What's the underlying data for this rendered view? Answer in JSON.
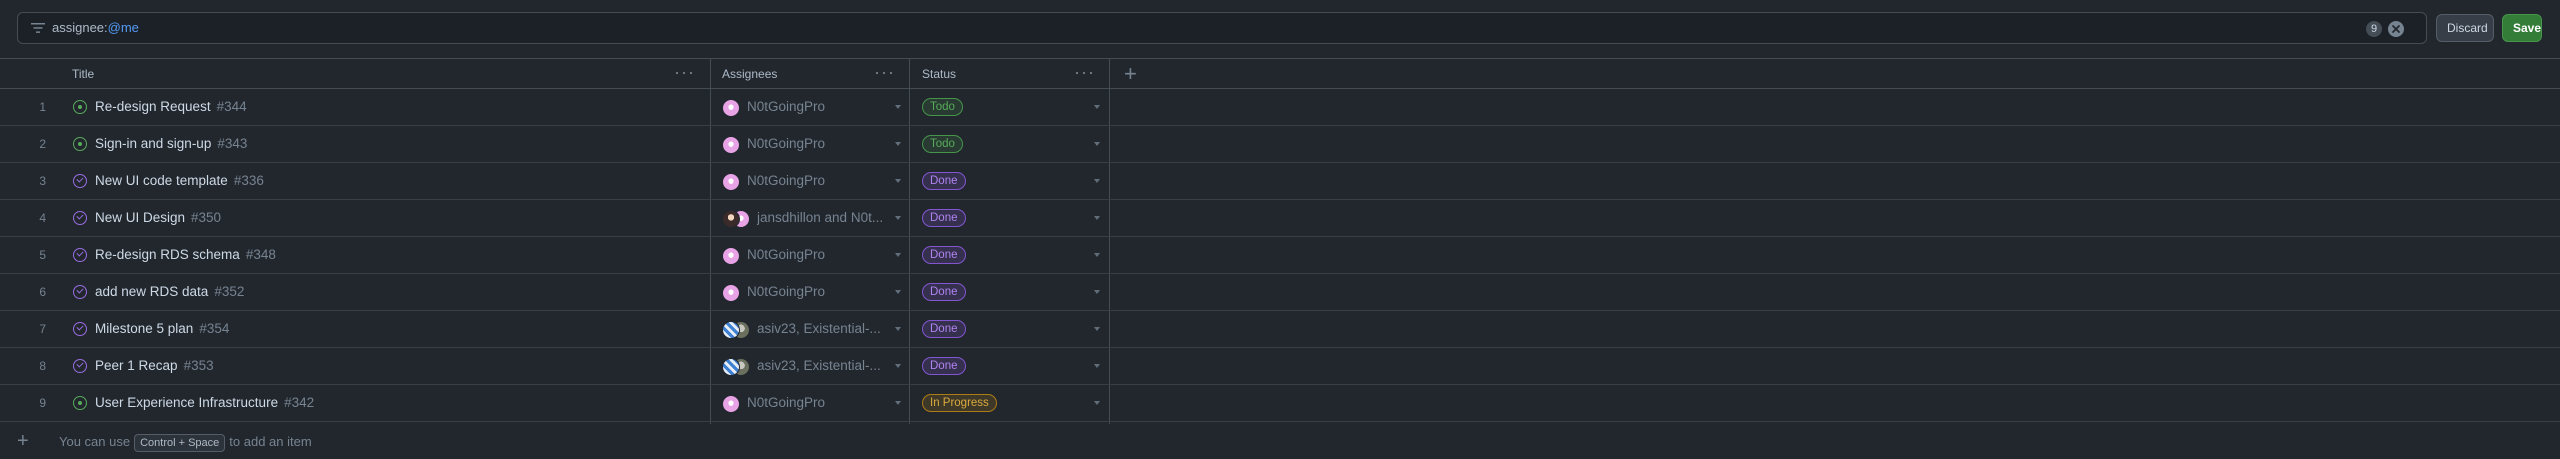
{
  "filter": {
    "prefix": "assignee:",
    "value": "@me",
    "count": "9",
    "icon": "filter-icon"
  },
  "toolbar": {
    "discard_label": "Discard",
    "save_label": "Save"
  },
  "columns": [
    {
      "label": "Title"
    },
    {
      "label": "Assignees"
    },
    {
      "label": "Status"
    }
  ],
  "add_column_icon": "+",
  "rows": [
    {
      "num": "1",
      "state": "open",
      "title": "Re-design Request",
      "number": "#344",
      "assignee": "N0tGoingPro",
      "status": "Todo"
    },
    {
      "num": "2",
      "state": "open",
      "title": "Sign-in and sign-up",
      "number": "#343",
      "assignee": "N0tGoingPro",
      "status": "Todo"
    },
    {
      "num": "3",
      "state": "closed",
      "title": "New UI code template",
      "number": "#336",
      "assignee": "N0tGoingPro",
      "status": "Done"
    },
    {
      "num": "4",
      "state": "closed",
      "title": "New UI Design",
      "number": "#350",
      "assignee": "jansdhillon and N0t...",
      "status": "Done"
    },
    {
      "num": "5",
      "state": "closed",
      "title": "Re-design RDS schema",
      "number": "#348",
      "assignee": "N0tGoingPro",
      "status": "Done"
    },
    {
      "num": "6",
      "state": "closed",
      "title": "add new RDS data",
      "number": "#352",
      "assignee": "N0tGoingPro",
      "status": "Done"
    },
    {
      "num": "7",
      "state": "closed",
      "title": "Milestone 5 plan",
      "number": "#354",
      "assignee": "asiv23, Existential-...",
      "status": "Done"
    },
    {
      "num": "8",
      "state": "closed",
      "title": "Peer 1 Recap",
      "number": "#353",
      "assignee": "asiv23, Existential-...",
      "status": "Done"
    },
    {
      "num": "9",
      "state": "open",
      "title": "User Experience Infrastructure",
      "number": "#342",
      "assignee": "N0tGoingPro",
      "status": "In Progress"
    }
  ],
  "footer": {
    "plus": "+",
    "text_before": "You can use",
    "shortcut": "Control + Space",
    "text_after": "to add an item"
  },
  "colors": {
    "background": "#22272e",
    "open": "#57ab5a",
    "closed": "#986ee2",
    "save": "#347d39",
    "in_progress": "#daaa3f"
  }
}
